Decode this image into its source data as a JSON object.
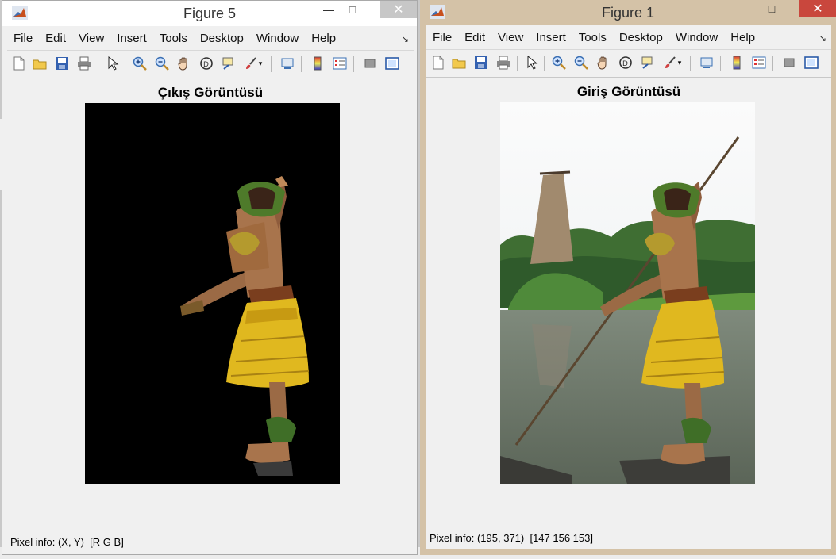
{
  "figure5": {
    "title": "Figure 5",
    "menu": [
      "File",
      "Edit",
      "View",
      "Insert",
      "Tools",
      "Desktop",
      "Window",
      "Help"
    ],
    "plot_title": "Çıkış Görüntüsü",
    "pixel_info": "Pixel info: (X, Y)  [R G B]"
  },
  "figure1": {
    "title": "Figure 1",
    "menu": [
      "File",
      "Edit",
      "View",
      "Insert",
      "Tools",
      "Desktop",
      "Window",
      "Help"
    ],
    "plot_title": "Giriş Görüntüsü",
    "pixel_info": "Pixel info: (195, 371)  [147 156 153]"
  },
  "toolbar_icons": [
    "new-figure-icon",
    "open-file-icon",
    "save-icon",
    "print-icon",
    "select-arrow-icon",
    "zoom-in-icon",
    "zoom-out-icon",
    "pan-hand-icon",
    "rotate-3d-icon",
    "data-cursor-icon",
    "brush-icon",
    "link-plot-icon",
    "colorbar-icon",
    "legend-icon",
    "hide-plot-tools-icon",
    "show-plot-tools-icon"
  ],
  "colors": {
    "active_frame": "#d4c2a7",
    "close_active": "#c9473d",
    "close_inactive": "#c7c7c7",
    "client_bg": "#f0f0f0"
  }
}
